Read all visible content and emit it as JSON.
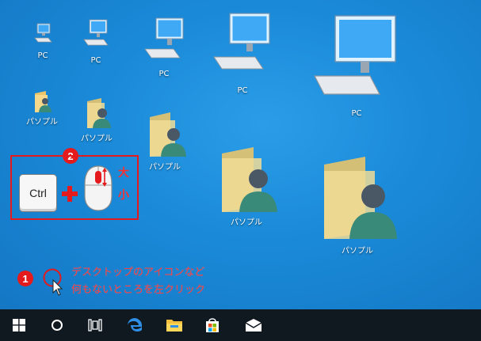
{
  "desktop": {
    "pc_label": "PC",
    "folder_label": "パソプル"
  },
  "callout": {
    "step_zoom": "2",
    "ctrl_key": "Ctrl",
    "size_large": "大",
    "size_small": "小",
    "step_click": "1",
    "instruction_line1": "デスクトップのアイコンなど",
    "instruction_line2": "何もないところを左クリック"
  },
  "taskbar": {
    "items": [
      "start-icon",
      "search-circle-icon",
      "task-view-icon",
      "edge-icon",
      "file-explorer-icon",
      "store-icon",
      "mail-icon"
    ]
  },
  "colors": {
    "desktop": "#1a8ad8",
    "taskbar": "#101820",
    "annotation_red": "#e41a1c"
  }
}
